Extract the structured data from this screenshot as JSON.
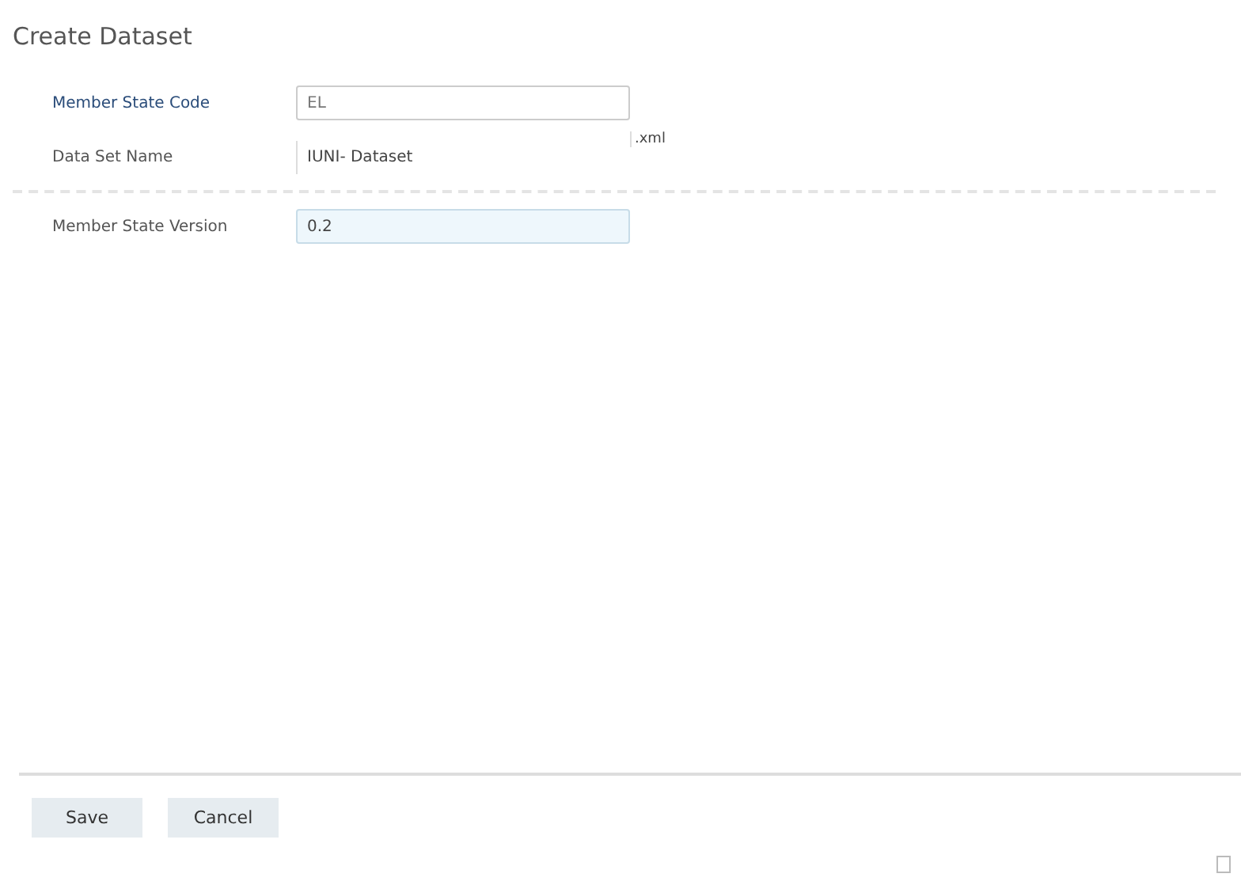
{
  "title": "Create Dataset",
  "fields": [
    {
      "label": "Member State Code",
      "kind": "input",
      "value": "EL",
      "focused": false
    },
    {
      "label": "Data Set Name",
      "kind": "text",
      "value": "IUNI- Dataset",
      "suffix": ".xml"
    },
    {
      "label": "Member State Version",
      "kind": "input",
      "value": "0.2",
      "focused": true
    }
  ],
  "buttons": [
    "Save",
    "Cancel"
  ]
}
